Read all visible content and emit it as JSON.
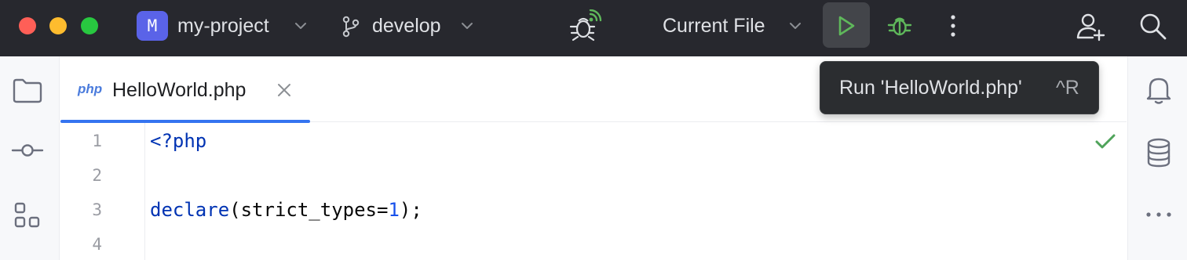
{
  "toolbar": {
    "project_initial": "M",
    "project_name": "my-project",
    "branch_name": "develop",
    "run_config": "Current File",
    "icons": {
      "branch": "git-branch-icon",
      "debug_profiler": "debug-bug-icon",
      "run": "run-play-icon",
      "debug": "debug-icon",
      "more": "more-vertical-icon",
      "add_user": "add-user-icon",
      "search": "search-icon"
    },
    "colors": {
      "background": "#27282e",
      "project_badge": "#5a63e8",
      "run_green": "#5fb85b"
    }
  },
  "tooltip": {
    "text": "Run 'HelloWorld.php'",
    "shortcut": "^R"
  },
  "left_strip": {
    "icons": [
      "folder-icon",
      "commit-icon",
      "structure-icon"
    ]
  },
  "right_strip": {
    "icons": [
      "notifications-icon",
      "database-icon",
      "more-horizontal-icon"
    ]
  },
  "editor": {
    "tab": {
      "file_type": "php",
      "label": "HelloWorld.php"
    },
    "line_numbers": [
      "1",
      "2",
      "3",
      "4"
    ],
    "lines": [
      {
        "tokens": [
          {
            "t": "<?php",
            "k": "kw"
          }
        ]
      },
      {
        "tokens": []
      },
      {
        "tokens": [
          {
            "t": "declare",
            "k": "kw"
          },
          {
            "t": "(strict_types=",
            "k": "plain"
          },
          {
            "t": "1",
            "k": "num"
          },
          {
            "t": ");",
            "k": "plain"
          }
        ]
      },
      {
        "tokens": []
      }
    ],
    "inspection_status": "no-problems-check-icon"
  }
}
